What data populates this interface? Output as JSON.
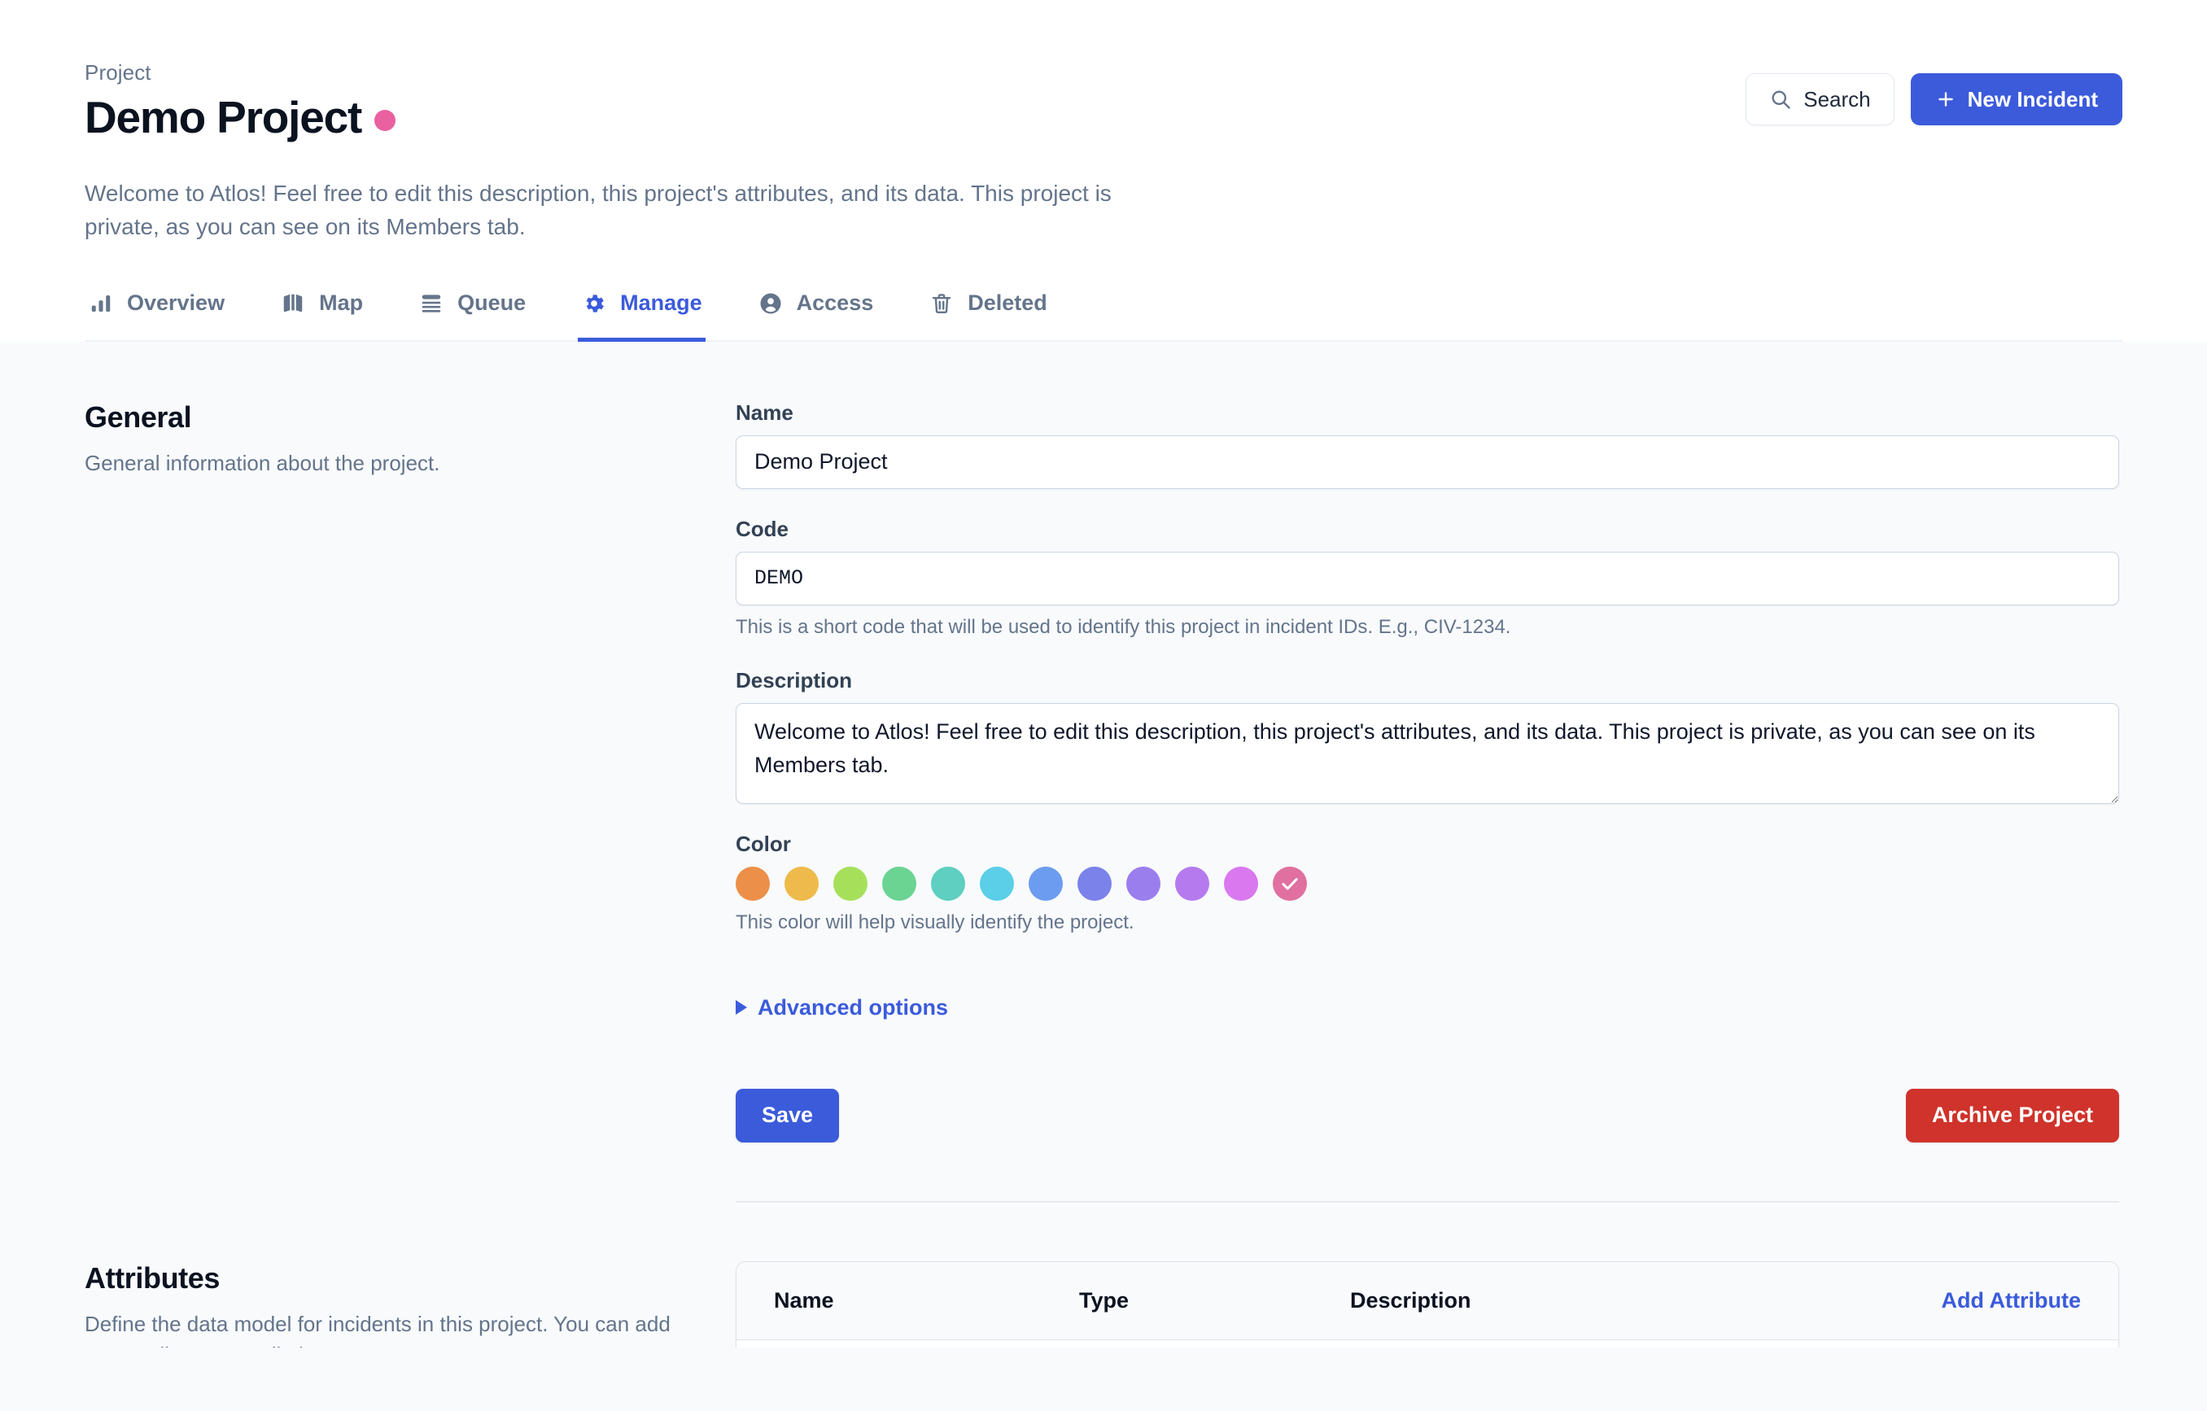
{
  "header": {
    "eyebrow": "Project",
    "title": "Demo Project",
    "dot_color": "#e9619f",
    "description": "Welcome to Atlos! Feel free to edit this description, this project's attributes, and its data. This project is private, as you can see on its Members tab.",
    "search_label": "Search",
    "new_incident_label": "New Incident",
    "accent_color": "#3B5BDB"
  },
  "tabs": [
    {
      "label": "Overview",
      "icon": "bar-chart-icon",
      "active": false
    },
    {
      "label": "Map",
      "icon": "map-icon",
      "active": false
    },
    {
      "label": "Queue",
      "icon": "queue-list-icon",
      "active": false
    },
    {
      "label": "Manage",
      "icon": "gear-icon",
      "active": true
    },
    {
      "label": "Access",
      "icon": "user-circle-icon",
      "active": false
    },
    {
      "label": "Deleted",
      "icon": "trash-icon",
      "active": false
    }
  ],
  "general": {
    "title": "General",
    "subtitle": "General information about the project.",
    "name": {
      "label": "Name",
      "value": "Demo Project",
      "placeholder": ""
    },
    "code": {
      "label": "Code",
      "value": "DEMO",
      "placeholder": "",
      "help": "This is a short code that will be used to identify this project in incident IDs. E.g., CIV-1234."
    },
    "description": {
      "label": "Description",
      "value": "Welcome to Atlos! Feel free to edit this description, this project's attributes, and its data. This project is private, as you can see on its Members tab.",
      "placeholder": ""
    },
    "color": {
      "label": "Color",
      "help": "This color will help visually identify the project.",
      "selected_index": 11,
      "swatches": [
        {
          "name": "orange",
          "hex": "#ec9049"
        },
        {
          "name": "amber",
          "hex": "#eeba4b"
        },
        {
          "name": "lime",
          "hex": "#a6e05a"
        },
        {
          "name": "green",
          "hex": "#6bd493"
        },
        {
          "name": "teal",
          "hex": "#5ecfc0"
        },
        {
          "name": "cyan",
          "hex": "#5bcfe8"
        },
        {
          "name": "blue",
          "hex": "#6c9cf0"
        },
        {
          "name": "indigo",
          "hex": "#7b82ea"
        },
        {
          "name": "violet",
          "hex": "#9b7eee"
        },
        {
          "name": "purple",
          "hex": "#b57bee"
        },
        {
          "name": "magenta",
          "hex": "#d濃"
        },
        {
          "name": "pink",
          "hex": "#e0709f"
        }
      ]
    },
    "advanced_options_label": "Advanced options",
    "save_label": "Save",
    "archive_label": "Archive Project"
  },
  "attributes": {
    "title": "Attributes",
    "subtitle": "Define the data model for incidents in this project. You can add new attributes, or edit the",
    "columns": [
      "Name",
      "Type",
      "Description"
    ],
    "add_label": "Add Attribute",
    "rows": []
  }
}
